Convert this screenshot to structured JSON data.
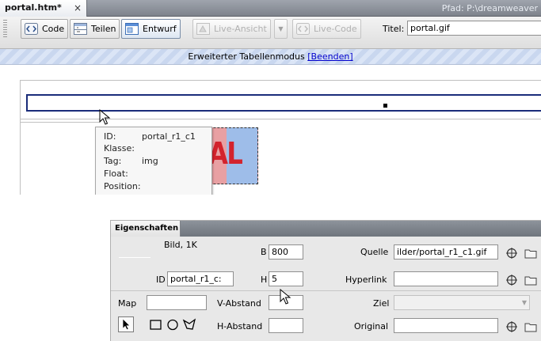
{
  "document": {
    "tab_label": "portal.htm*",
    "tab_close_glyph": "×",
    "path": "Pfad:  P:\\dreamweaver"
  },
  "toolbar": {
    "code_label": "Code",
    "split_label": "Teilen",
    "design_label": "Entwurf",
    "live_view_label": "Live-Ansicht",
    "live_code_label": "Live-Code",
    "title_label": "Titel:",
    "title_value": "portal.gif"
  },
  "table_mode": {
    "text": "Erweiterter Tabellenmodus",
    "end_link": "[Beenden]"
  },
  "image": {
    "logo_text": "AL"
  },
  "tooltip": {
    "id_label": "ID:",
    "id_value": "portal_r1_c1",
    "class_label": "Klasse:",
    "tag_label": "Tag:",
    "tag_value": "img",
    "float_label": "Float:",
    "position_label": "Position:"
  },
  "properties": {
    "panel_title": "Eigenschaften",
    "image_info": "Bild, 1K",
    "id_label": "ID",
    "id_value": "portal_r1_c:",
    "w_label": "B",
    "w_value": "800",
    "h_label": "H",
    "h_value": "5",
    "src_label": "Quelle",
    "src_value": "ilder/portal_r1_c1.gif",
    "link_label": "Hyperlink",
    "link_value": "",
    "map_label": "Map",
    "map_value": "",
    "vspace_label": "V-Abstand",
    "vspace_value": "",
    "hspace_label": "H-Abstand",
    "hspace_value": "",
    "target_label": "Ziel",
    "target_value": "",
    "original_label": "Original",
    "original_value": ""
  },
  "colors": {
    "accent_blue": "#1a2c7a",
    "link_blue": "#0000cc",
    "logo_red": "#d3232d"
  }
}
